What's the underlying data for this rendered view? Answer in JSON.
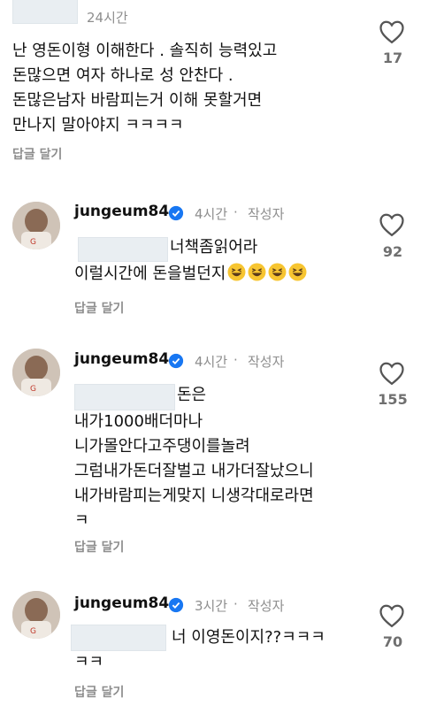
{
  "comment0": {
    "time": "24시간",
    "text": "난 영돈이형 이해한다 . 솔직히 능력있고\n돈많으면 여자 하나로 성 안찬다 .\n돈많은남자 바람피는거 이해 못할거면\n만나지 말아야지 ㅋㅋㅋㅋ",
    "reply_label": "답글 달기",
    "likes": "17"
  },
  "comment1": {
    "username": "jungeum84",
    "time": "4시간",
    "author_tag": "작성자",
    "line1": "너책좀읽어라",
    "line2": "이럴시간에 돈을벌던지",
    "reply_label": "답글 달기",
    "likes": "92"
  },
  "comment2": {
    "username": "jungeum84",
    "time": "4시간",
    "author_tag": "작성자",
    "line1": "돈은",
    "rest": "내가1000배더마나\n니가몰안다고주댕이를놀려\n그럼내가돈더잘벌고 내가더잘났으니\n내가바람피는게맞지 니생각대로라면\nㅋ",
    "reply_label": "답글 달기",
    "likes": "155"
  },
  "comment3": {
    "username": "jungeum84",
    "time": "3시간",
    "author_tag": "작성자",
    "line1": "너 이영돈이지??ㅋㅋㅋ",
    "line2": "ㅋㅋ",
    "reply_label": "답글 달기",
    "likes": "70"
  },
  "colors": {
    "verified": "#1877f2",
    "muted": "#8e8e8e",
    "mention_blur": "#e9eef2"
  },
  "icons": {
    "like": "heart-outline-icon",
    "verified": "verified-badge-icon",
    "emoji": "grinning-squinting-face-emoji"
  }
}
